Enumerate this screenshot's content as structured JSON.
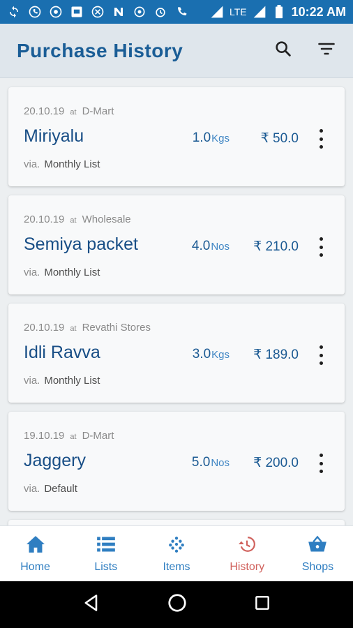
{
  "statusbar": {
    "network": "LTE",
    "time": "10:22 AM",
    "icons": [
      "sync-icon",
      "whatsapp-icon",
      "chrome-icon",
      "tv-icon",
      "compass-icon",
      "n-icon",
      "gear-icon",
      "alarm-icon",
      "wifi-calling-icon",
      "signal-icon",
      "signal-icon",
      "battery-icon"
    ]
  },
  "appbar": {
    "title": "Purchase History",
    "actions": [
      "search-icon",
      "filter-icon"
    ]
  },
  "purchases": [
    {
      "date": "20.10.19",
      "at": "at",
      "shop": "D-Mart",
      "item": "Miriyalu",
      "qty": "1.0",
      "unit": "Kgs",
      "price": "₹ 50.0",
      "via_label": "via.",
      "via": "Monthly List"
    },
    {
      "date": "20.10.19",
      "at": "at",
      "shop": "Wholesale",
      "item": "Semiya packet",
      "qty": "4.0",
      "unit": "Nos",
      "price": "₹ 210.0",
      "via_label": "via.",
      "via": "Monthly List"
    },
    {
      "date": "20.10.19",
      "at": "at",
      "shop": "Revathi Stores",
      "item": "Idli Ravva",
      "qty": "3.0",
      "unit": "Kgs",
      "price": "₹ 189.0",
      "via_label": "via.",
      "via": "Monthly List"
    },
    {
      "date": "19.10.19",
      "at": "at",
      "shop": "D-Mart",
      "item": "Jaggery",
      "qty": "5.0",
      "unit": "Nos",
      "price": "₹ 200.0",
      "via_label": "via.",
      "via": "Default"
    }
  ],
  "bottomnav": {
    "items": [
      {
        "label": "Home",
        "icon": "home-icon"
      },
      {
        "label": "Lists",
        "icon": "list-icon"
      },
      {
        "label": "Items",
        "icon": "items-icon"
      },
      {
        "label": "History",
        "icon": "history-icon",
        "active": true
      },
      {
        "label": "Shops",
        "icon": "basket-icon"
      }
    ]
  },
  "colors": {
    "statusbar": "#1a6fb0",
    "title": "#1a5d96",
    "accent": "#2f7ec1",
    "active": "#d0615c"
  },
  "sysnav": [
    "back-icon",
    "home-circle-icon",
    "recents-icon"
  ]
}
